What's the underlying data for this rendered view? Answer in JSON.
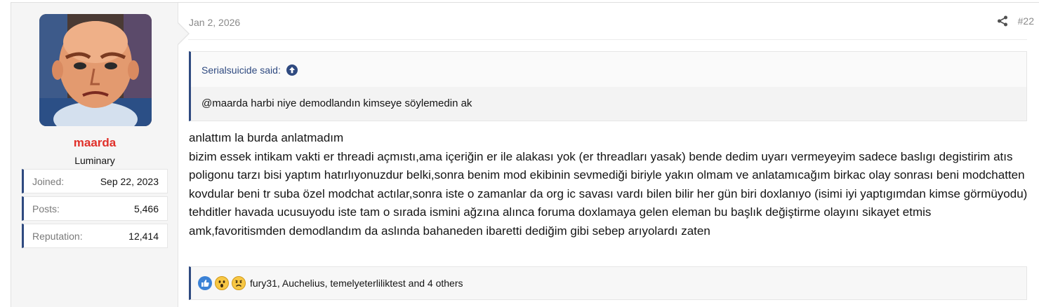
{
  "post": {
    "date": "Jan 2, 2026",
    "number": "#22",
    "user": {
      "name": "maarda",
      "title": "Luminary",
      "stats": [
        {
          "label": "Joined:",
          "value": "Sep 22, 2023"
        },
        {
          "label": "Posts:",
          "value": "5,466"
        },
        {
          "label": "Reputation:",
          "value": "12,414"
        }
      ]
    },
    "quote": {
      "author_said": "Serialsuicide said:",
      "text": "@maarda harbi niye demodlandın kimseye söylemedin ak"
    },
    "message": [
      "anlattım la burda anlatmadım",
      "bizim essek intikam vakti er threadi açmıstı,ama içeriğin er ile alakası yok (er threadları yasak) bende dedim uyarı vermeyeyim sadece baslıgı degistirim atıs poligonu tarzı bisi yaptım hatırlıyonuzdur belki,sonra benim mod ekibinin sevmediği biriyle yakın olmam ve anlatamıcağım birkac olay sonrası beni modchatten kovdular beni tr suba özel modchat actılar,sonra iste o zamanlar da org ic savası vardı bilen bilir her gün biri doxlanıyo (isimi iyi yaptıgımdan kimse görmüyodu) tehditler havada ucusuyodu iste tam o sırada ismini ağzına alınca foruma doxlamaya gelen eleman bu başlık değiştirme olayını sikayet etmis amk,favoritismden demodlandım da aslında bahaneden ibaretti dediğim gibi sebep arıyolardı zaten"
    ],
    "reactions": {
      "icons": [
        "like-icon",
        "wow-icon",
        "sad-icon"
      ],
      "summary": "fury31, Auchelius, temelyeterliliktest and 4 others"
    }
  },
  "colors": {
    "accent": "#2f4a80",
    "username": "#e0302a",
    "muted": "#8a8a8a"
  }
}
